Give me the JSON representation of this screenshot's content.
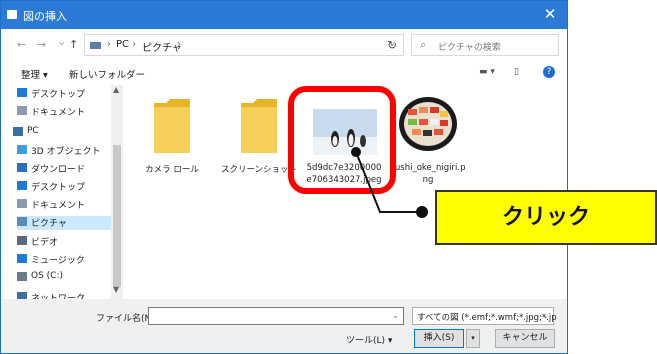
{
  "window": {
    "title": "図の挿入",
    "close": "✕"
  },
  "nav": {
    "back": "←",
    "forward": "→",
    "recent": "⌄",
    "up": "↑",
    "breadcrumb": [
      "PC",
      "ピクチャ"
    ],
    "separator": "›",
    "refresh": "↻",
    "search_placeholder": "ピクチャの検索"
  },
  "toolbar": {
    "organize": "整理 ▾",
    "new_folder": "新しいフォルダー",
    "view": "▬ ▾",
    "pane": "▯",
    "help": "?"
  },
  "sidebar": {
    "items": [
      {
        "label": "デスクトップ",
        "icon": "desktop-icon",
        "color": "#1e7bd4"
      },
      {
        "label": "ドキュメント",
        "icon": "document-icon",
        "color": "#8a9bb0"
      },
      {
        "label": "PC",
        "icon": "pc-icon",
        "color": "#3a6ea5"
      },
      {
        "label": "3D オブジェクト",
        "icon": "cube-icon",
        "color": "#3aa0e0"
      },
      {
        "label": "ダウンロード",
        "icon": "download-icon",
        "color": "#2a6fc0"
      },
      {
        "label": "デスクトップ",
        "icon": "desktop-icon",
        "color": "#1e7bd4"
      },
      {
        "label": "ドキュメント",
        "icon": "document-icon",
        "color": "#8a9bb0"
      },
      {
        "label": "ピクチャ",
        "icon": "pictures-icon",
        "color": "#5a8ac0"
      },
      {
        "label": "ビデオ",
        "icon": "video-icon",
        "color": "#5a6a80"
      },
      {
        "label": "ミュージック",
        "icon": "music-icon",
        "color": "#1e7bd4"
      },
      {
        "label": "OS (C:)",
        "icon": "drive-icon",
        "color": "#6a7a8a"
      },
      {
        "label": "ネットワーク",
        "icon": "network-icon",
        "color": "#3a6ea5"
      }
    ],
    "selected_index": 7
  },
  "files": [
    {
      "name": "カメラ ロール",
      "type": "folder"
    },
    {
      "name": "スクリーンショット",
      "type": "folder"
    },
    {
      "name": "5d9dc7e3200000e706343027.jpeg",
      "name_lines": [
        "5d9dc7e3200000",
        "e706343027.jpeg"
      ],
      "type": "image-penguins"
    },
    {
      "name": "sushi_oke_nigiri.png",
      "name_lines": [
        "sushi_oke_nigiri.p",
        "ng"
      ],
      "type": "image-sushi"
    }
  ],
  "bottom": {
    "filename_label": "ファイル名(N):",
    "filename_value": "",
    "filter": "すべての図 (*.emf;*.wmf;*.jpg;*.jp",
    "tools": "ツール(L) ▾",
    "insert": "挿入(S)",
    "insert_dd": "▾",
    "cancel": "キャンセル"
  },
  "annotation": {
    "label": "クリック",
    "highlight_color": "#ff0000",
    "callout_color": "#ffff00"
  }
}
